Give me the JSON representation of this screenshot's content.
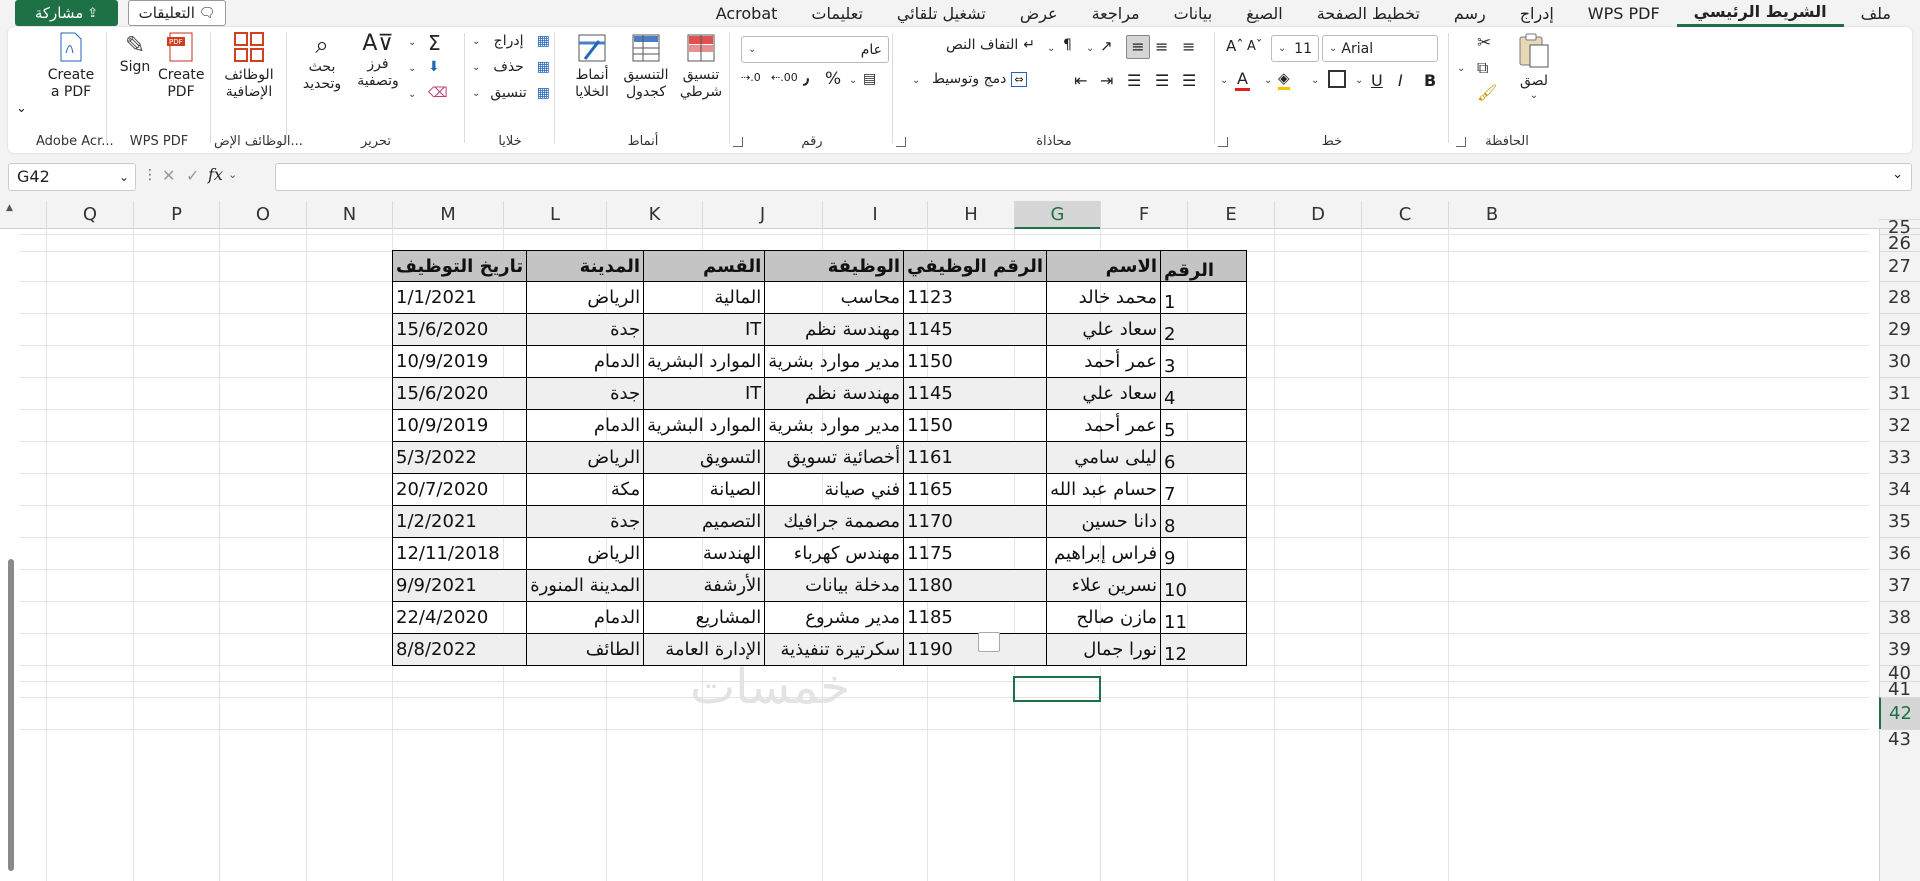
{
  "tabs": [
    "ملف",
    "الشريط الرئيسي",
    "WPS PDF",
    "إدراج",
    "رسم",
    "تخطيط الصفحة",
    "الصيغ",
    "بيانات",
    "مراجعة",
    "عرض",
    "تشغيل تلقائي",
    "تعليمات",
    "Acrobat"
  ],
  "active_tab": "الشريط الرئيسي",
  "share_label": "مشاركة",
  "comments_label": "التعليقات",
  "accent_color": "#1e7145",
  "ribbon": {
    "clipboard": {
      "label": "الحافظة",
      "paste": "لصق"
    },
    "font": {
      "label": "خط",
      "font_name": "Arial",
      "font_size": "11"
    },
    "alignment": {
      "label": "محاذاة",
      "wrap_text": "التفاف النص",
      "merge_center": "دمج وتوسيط"
    },
    "number": {
      "label": "رقم",
      "format": "عام"
    },
    "styles": {
      "label": "أنماط",
      "conditional": "تنسيق\nشرطي",
      "as_table": "التنسيق\nكجدول",
      "cell_styles": "أنماط\nالخلايا"
    },
    "cells": {
      "label": "خلايا",
      "insert": "إدراج",
      "delete": "حذف",
      "format": "تنسيق"
    },
    "editing": {
      "label": "تحرير",
      "sort_filter": "فرز\nوتصفية",
      "find_select": "بحث\nوتحديد"
    },
    "addins": {
      "label": "الوظائف الإض...",
      "addins_btn": "الوظائف\nالإضافية"
    },
    "wps": {
      "label": "WPS PDF",
      "create_pdf": "Create\nPDF",
      "sign": "Sign"
    },
    "adobe": {
      "label": "Adobe Acr...",
      "create_pdf": "Create\na PDF"
    }
  },
  "name_box": "G42",
  "formula_value": "",
  "columns": [
    "B",
    "C",
    "D",
    "E",
    "F",
    "G",
    "H",
    "I",
    "J",
    "K",
    "L",
    "M",
    "N",
    "O",
    "P",
    "Q"
  ],
  "selected_column": "G",
  "rows": [
    "25",
    "26",
    "27",
    "28",
    "29",
    "30",
    "31",
    "32",
    "33",
    "34",
    "35",
    "36",
    "37",
    "38",
    "39",
    "40",
    "41",
    "42",
    "43"
  ],
  "selected_row": "42",
  "table": {
    "headers": [
      "الرقم",
      "الاسم",
      "الرقم الوظيفي",
      "الوظيفة",
      "القسم",
      "المدينة",
      "تاريخ التوظيف"
    ],
    "rows": [
      [
        "1",
        "محمد خالد",
        "1123",
        "محاسب",
        "المالية",
        "الرياض",
        "1/1/2021"
      ],
      [
        "2",
        "سعاد علي",
        "1145",
        "مهندسة نظم",
        "IT",
        "جدة",
        "15/6/2020"
      ],
      [
        "3",
        "عمر أحمد",
        "1150",
        "مدير موارد بشرية",
        "الموارد البشرية",
        "الدمام",
        "10/9/2019"
      ],
      [
        "4",
        "سعاد علي",
        "1145",
        "مهندسة نظم",
        "IT",
        "جدة",
        "15/6/2020"
      ],
      [
        "5",
        "عمر أحمد",
        "1150",
        "مدير موارد بشرية",
        "الموارد البشرية",
        "الدمام",
        "10/9/2019"
      ],
      [
        "6",
        "ليلى سامي",
        "1161",
        "أخصائية تسويق",
        "التسويق",
        "الرياض",
        "5/3/2022"
      ],
      [
        "7",
        "حسام عبد الله",
        "1165",
        "فني صيانة",
        "الصيانة",
        "مكة",
        "20/7/2020"
      ],
      [
        "8",
        "دانا حسين",
        "1170",
        "مصممة جرافيك",
        "التصميم",
        "جدة",
        "1/2/2021"
      ],
      [
        "9",
        "فراس إبراهيم",
        "1175",
        "مهندس كهرباء",
        "الهندسة",
        "الرياض",
        "12/11/2018"
      ],
      [
        "10",
        "نسرين علاء",
        "1180",
        "مدخلة بيانات",
        "الأرشفة",
        "المدينة المنورة",
        "9/9/2021"
      ],
      [
        "11",
        "مازن صالح",
        "1185",
        "مدير مشروع",
        "المشاريع",
        "الدمام",
        "22/4/2020"
      ],
      [
        "12",
        "نورا جمال",
        "1190",
        "سكرتيرة تنفيذية",
        "الإدارة العامة",
        "الطائف",
        "8/8/2022"
      ]
    ]
  },
  "watermark": "خمسات"
}
